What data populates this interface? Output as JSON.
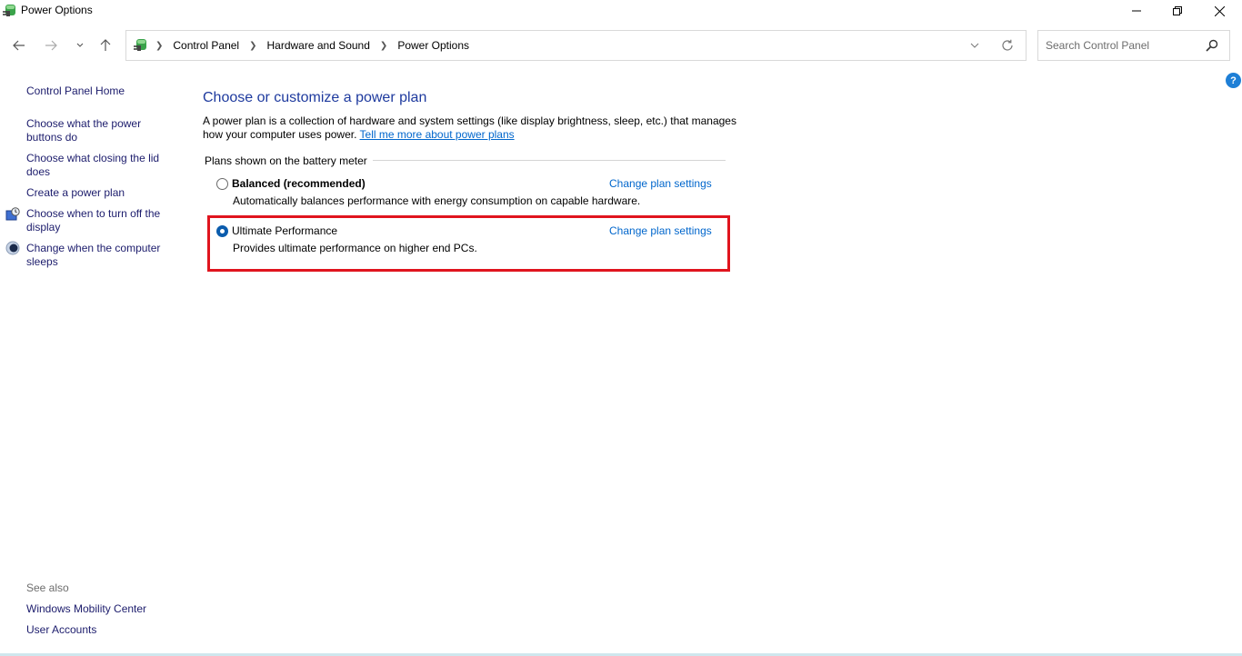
{
  "window": {
    "title": "Power Options",
    "icon": "power-options-icon",
    "controls": {
      "minimize": "minimize-icon",
      "maximize": "restore-icon",
      "close": "close-icon"
    }
  },
  "navigation": {
    "back": "back-arrow-icon",
    "forward": "forward-arrow-icon",
    "recent": "chevron-down-icon",
    "up": "up-arrow-icon",
    "breadcrumb": [
      "Control Panel",
      "Hardware and Sound",
      "Power Options"
    ],
    "search": {
      "placeholder": "Search Control Panel",
      "value": ""
    }
  },
  "help": {
    "label": "?"
  },
  "sidebar": {
    "home": "Control Panel Home",
    "links": [
      {
        "label": "Choose what the power buttons do",
        "icon": null
      },
      {
        "label": "Choose what closing the lid does",
        "icon": null
      },
      {
        "label": "Create a power plan",
        "icon": null
      },
      {
        "label": "Choose when to turn off the display",
        "icon": "display-timer-icon"
      },
      {
        "label": "Change when the computer sleeps",
        "icon": "sleep-moon-icon"
      }
    ],
    "see_also": {
      "heading": "See also",
      "links": [
        "Windows Mobility Center",
        "User Accounts"
      ]
    }
  },
  "main": {
    "title": "Choose or customize a power plan",
    "description": "A power plan is a collection of hardware and system settings (like display brightness, sleep, etc.) that manages how your computer uses power.",
    "learn_more_link": "Tell me more about power plans",
    "group_label": "Plans shown on the battery meter",
    "plans": [
      {
        "name": "Balanced (recommended)",
        "description": "Automatically balances performance with energy consumption on capable hardware.",
        "selected": false,
        "link": "Change plan settings"
      },
      {
        "name": "Ultimate Performance",
        "description": "Provides ultimate performance on higher end PCs.",
        "selected": true,
        "link": "Change plan settings",
        "highlighted": true
      }
    ]
  },
  "colors": {
    "accent_link": "#0066cc",
    "title_blue": "#1e3a9e",
    "sidebar_link": "#1c1c6c",
    "highlight_red": "#e0141e",
    "radio_selected": "#0b5cad"
  }
}
